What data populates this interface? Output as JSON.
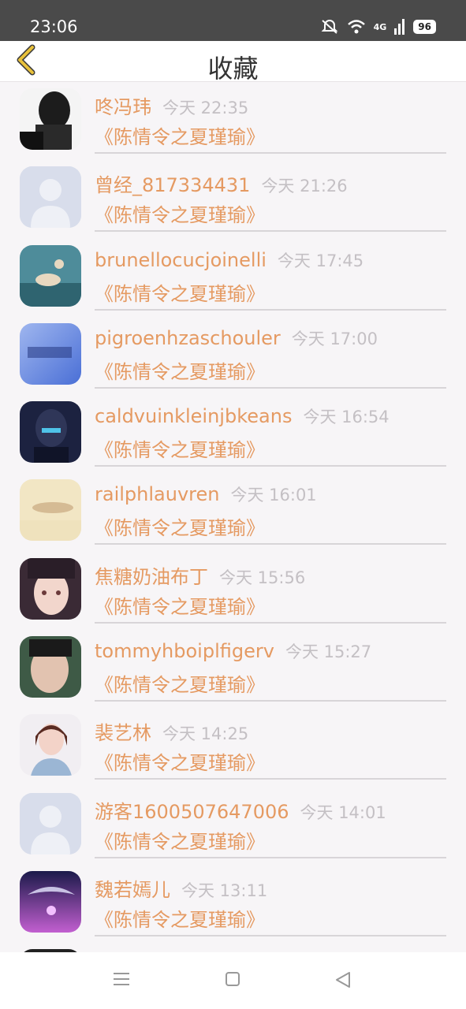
{
  "status": {
    "time": "23:06",
    "network": "4G",
    "battery": "96"
  },
  "header": {
    "title": "收藏"
  },
  "items": [
    {
      "name": "咚冯玮",
      "time": "今天 22:35",
      "story": "《陈情令之夏瑾瑜》"
    },
    {
      "name": "曾经_817334431",
      "time": "今天 21:26",
      "story": "《陈情令之夏瑾瑜》"
    },
    {
      "name": "brunellocucjoinelli",
      "time": "今天 17:45",
      "story": "《陈情令之夏瑾瑜》"
    },
    {
      "name": "pigroenhzaschouler",
      "time": "今天 17:00",
      "story": "《陈情令之夏瑾瑜》"
    },
    {
      "name": "caldvuinkleinjbkeans",
      "time": "今天 16:54",
      "story": "《陈情令之夏瑾瑜》"
    },
    {
      "name": "railphlauvren",
      "time": "今天 16:01",
      "story": "《陈情令之夏瑾瑜》"
    },
    {
      "name": "焦糖奶油布丁",
      "time": "今天 15:56",
      "story": "《陈情令之夏瑾瑜》"
    },
    {
      "name": "tommyhboiplfigerv",
      "time": "今天 15:27",
      "story": "《陈情令之夏瑾瑜》"
    },
    {
      "name": "裴艺林",
      "time": "今天 14:25",
      "story": "《陈情令之夏瑾瑜》"
    },
    {
      "name": "游客1600507647006",
      "time": "今天 14:01",
      "story": "《陈情令之夏瑾瑜》"
    },
    {
      "name": "魏若嫣儿",
      "time": "今天 13:11",
      "story": "《陈情令之夏瑾瑜》"
    }
  ],
  "colors": {
    "accent": "#e59a62",
    "back_arrow": "#e8c13b"
  }
}
